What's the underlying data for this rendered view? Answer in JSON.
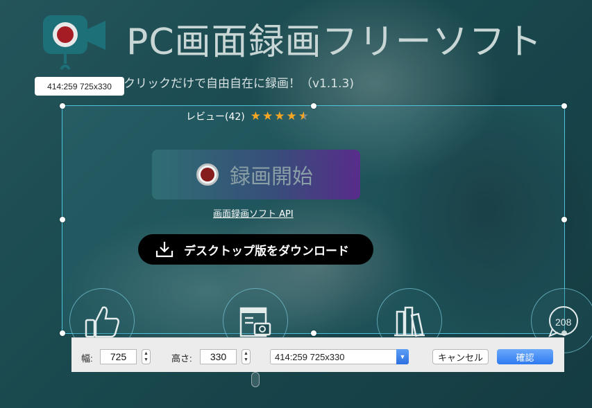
{
  "app": {
    "title": "PC画面録画フリーソフト",
    "subtitle": "クリックだけで自由自在に録画！（v1.1.3)"
  },
  "tooltip": {
    "size_text": "414:259 725x330"
  },
  "review": {
    "label": "レビュー(42)",
    "rating": 4.5,
    "max": 5
  },
  "record_button": {
    "label": "録画開始"
  },
  "api_link": {
    "label": "画面録画ソフト API"
  },
  "download_button": {
    "label": "デスクトップ版をダウンロード"
  },
  "features": {
    "counter": "208"
  },
  "toolbar": {
    "width_label": "幅:",
    "width_value": "725",
    "height_label": "高さ:",
    "height_value": "330",
    "preset_value": "414:259 725x330",
    "cancel_label": "キャンセル",
    "ok_label": "確認"
  },
  "colors": {
    "selection_border": "#4fc3de",
    "star": "#f5a623",
    "ok_button": "#2f7bf0",
    "logo": "#1d6f78"
  },
  "icons": {
    "logo": "webcam-record-icon",
    "download": "download-icon",
    "thumbs_up": "thumbs-up-icon",
    "camera": "camera-document-icon",
    "books": "books-icon",
    "chat": "chat-counter-icon"
  }
}
